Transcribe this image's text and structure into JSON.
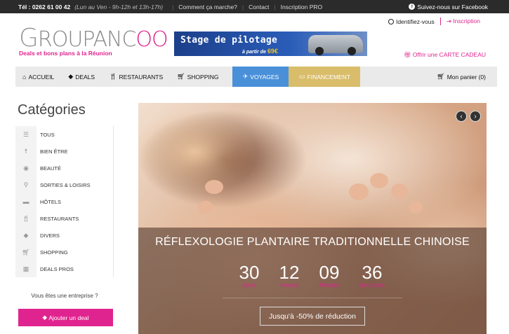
{
  "topbar": {
    "phone": "Tél : 0262 61 00 42",
    "hours": "(Lun au Ven - 9h-12h et 13h-17h)",
    "links": [
      "Comment ça marche?",
      "Contact",
      "Inscription PRO"
    ],
    "facebook": "Suivez-nous sur Facebook"
  },
  "logo": {
    "brand_start": "G",
    "brand_mid": "ROUPANC",
    "brand_end": "OO",
    "tagline": "Deals et bons plans à la Réunion"
  },
  "banner": {
    "title": "Stage de pilotage",
    "sub": "à partir de",
    "price": "69€"
  },
  "account": {
    "login": "Identifiez-vous",
    "register": "Inscription",
    "gift": "Offrir une CARTE CADEAU"
  },
  "nav": {
    "accueil": "ACCUEIL",
    "deals": "DEALS",
    "restaurants": "RESTAURANTS",
    "shopping": "SHOPPING",
    "voyages": "VOYAGES",
    "financement": "FINANCEMENT",
    "cart": "Mon panier (0)"
  },
  "sidebar": {
    "title": "Catégories",
    "items": [
      {
        "label": "TOUS",
        "icon": "list-icon"
      },
      {
        "label": "BIEN ÊTRE",
        "icon": "person-icon"
      },
      {
        "label": "BEAUTÉ",
        "icon": "eye-icon"
      },
      {
        "label": "SORTIES & LOISIRS",
        "icon": "bicycle-icon"
      },
      {
        "label": "HÔTELS",
        "icon": "bed-icon"
      },
      {
        "label": "RESTAURANTS",
        "icon": "cutlery-icon"
      },
      {
        "label": "DIVERS",
        "icon": "tag-icon"
      },
      {
        "label": "SHOPPING",
        "icon": "cart-icon"
      },
      {
        "label": "DEALS PROS",
        "icon": "building-icon"
      }
    ],
    "entreprise": "Vous êtes une entreprise ?",
    "add_deal": "Ajouter un deal"
  },
  "hero": {
    "title": "RÉFLEXOLOGIE PLANTAIRE TRADITIONNELLE CHINOISE",
    "countdown": [
      {
        "value": "30",
        "label": "Jours"
      },
      {
        "value": "12",
        "label": "Heures"
      },
      {
        "value": "09",
        "label": "Minutes"
      },
      {
        "value": "36",
        "label": "Secondes"
      }
    ],
    "cta": "Jusqu'à -50% de réduction"
  }
}
